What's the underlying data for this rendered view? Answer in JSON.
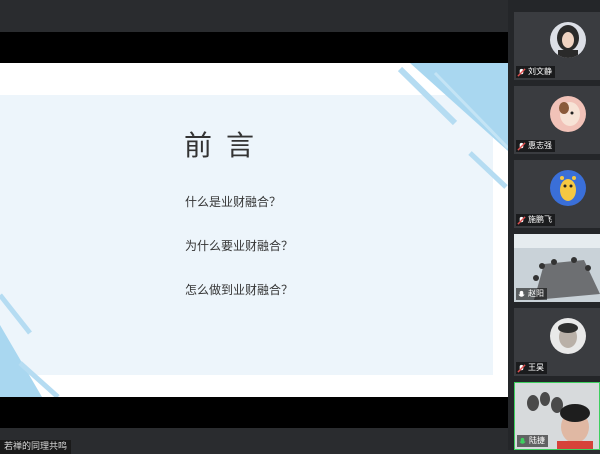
{
  "slide": {
    "title": "前言",
    "questions": [
      "什么是业财融合？",
      "为什么要业财融合？",
      "怎么做到业财融合？"
    ]
  },
  "caption": {
    "text": "若禅的同理共鸣"
  },
  "participants": [
    {
      "name": "刘文静",
      "mic": "muted",
      "avatar": "woman-portrait"
    },
    {
      "name": "惠志强",
      "mic": "muted",
      "avatar": "cartoon-character"
    },
    {
      "name": "施鹏飞",
      "mic": "muted",
      "avatar": "giraffe-cartoon"
    },
    {
      "name": "赵阳",
      "mic": "on",
      "avatar": "meeting-room-video"
    },
    {
      "name": "王昊",
      "mic": "muted",
      "avatar": "man-portrait"
    },
    {
      "name": "陆捷",
      "mic": "on",
      "avatar": "woman-video",
      "active": true
    }
  ],
  "colors": {
    "accent_blue": "#9fd2ee",
    "active_speaker": "#3ecf5f",
    "mic_on": "#3ecf5f",
    "mic_muted": "#e05050"
  }
}
